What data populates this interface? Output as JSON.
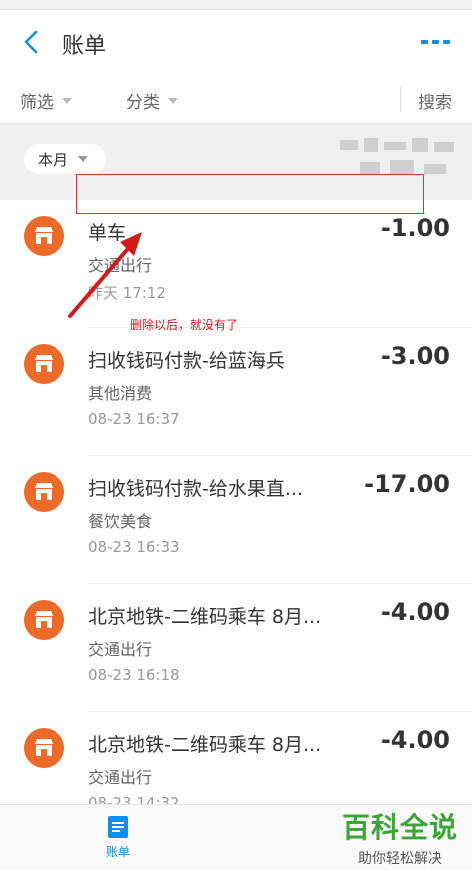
{
  "header": {
    "title": "账单"
  },
  "filters": {
    "filter_label": "筛选",
    "category_label": "分类",
    "search_label": "搜索"
  },
  "month": {
    "label": "本月"
  },
  "transactions": [
    {
      "name": "单车",
      "category": "交通出行",
      "time": "昨天  17:12",
      "amount": "-1.00"
    },
    {
      "name": "扫收钱码付款-给蓝海兵",
      "category": "其他消费",
      "time": "08-23  16:37",
      "amount": "-3.00"
    },
    {
      "name": "扫收钱码付款-给水果直...",
      "category": "餐饮美食",
      "time": "08-23  16:33",
      "amount": "-17.00"
    },
    {
      "name": "北京地铁-二维码乘车 8月...",
      "category": "交通出行",
      "time": "08-23  16:18",
      "amount": "-4.00"
    },
    {
      "name": "北京地铁-二维码乘车 8月...",
      "category": "交通出行",
      "time": "08-23  14:32",
      "amount": "-4.00"
    }
  ],
  "annotation": {
    "text": "删除以后，就没有了"
  },
  "tabbar": {
    "bill_label": "账单"
  },
  "watermark": {
    "title": "百科全说",
    "subtitle": "助你轻松解决"
  },
  "colors": {
    "accent": "#108ee9",
    "icon_bg": "#ee6a27",
    "annotation": "#d21a1a",
    "watermark": "#3aa635"
  }
}
